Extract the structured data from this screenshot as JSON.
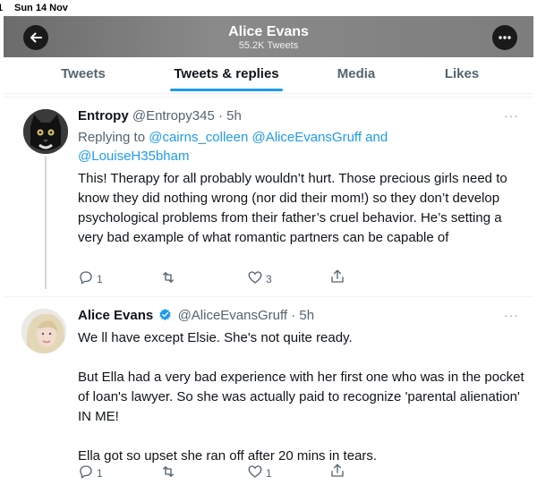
{
  "status_bar": {
    "time": "1",
    "date": "Sun 14 Nov"
  },
  "header": {
    "title": "Alice Evans",
    "subtitle": "55.2K Tweets"
  },
  "tabs": [
    {
      "label": "Tweets"
    },
    {
      "label": "Tweets & replies"
    },
    {
      "label": "Media"
    },
    {
      "label": "Likes"
    }
  ],
  "tweets": [
    {
      "name": "Entropy",
      "handle": "@Entropy345",
      "dot": "·",
      "time": "5h",
      "more": "···",
      "replying_to_label": "Replying to",
      "reply_handles_1": "@cairns_colleen @AliceEvansGruff",
      "reply_and": "and",
      "reply_handles_2": "@LouiseH35bham",
      "text": "This! Therapy for all probably wouldn’t hurt. Those precious girls need to know they did nothing wrong (nor did their mom!) so they don’t develop psychological problems from their father’s cruel behavior. He’s setting a very bad example of what romantic partners can be capable of",
      "reply_count": "1",
      "retweet_count": "",
      "like_count": "3"
    },
    {
      "name": "Alice Evans",
      "handle": "@AliceEvansGruff",
      "dot": "·",
      "time": "5h",
      "more": "···",
      "text_1": "We ll have except Elsie. She's not quite ready.",
      "text_2": "But Ella had a very bad experience with her first one who was in the pocket of loan's lawyer. So she was actually paid to recognize 'parental alienation' IN ME!",
      "text_3": "Ella got so upset she ran off after 20 mins in tears.",
      "reply_count": "1",
      "retweet_count": "",
      "like_count": "1"
    }
  ],
  "colors": {
    "accent": "#1d9bf0",
    "text": "#0f1419",
    "muted": "#536471"
  },
  "icons": [
    "back-arrow-icon",
    "more-options-icon",
    "reply-icon",
    "retweet-icon",
    "like-icon",
    "share-icon",
    "verified-badge-icon"
  ]
}
